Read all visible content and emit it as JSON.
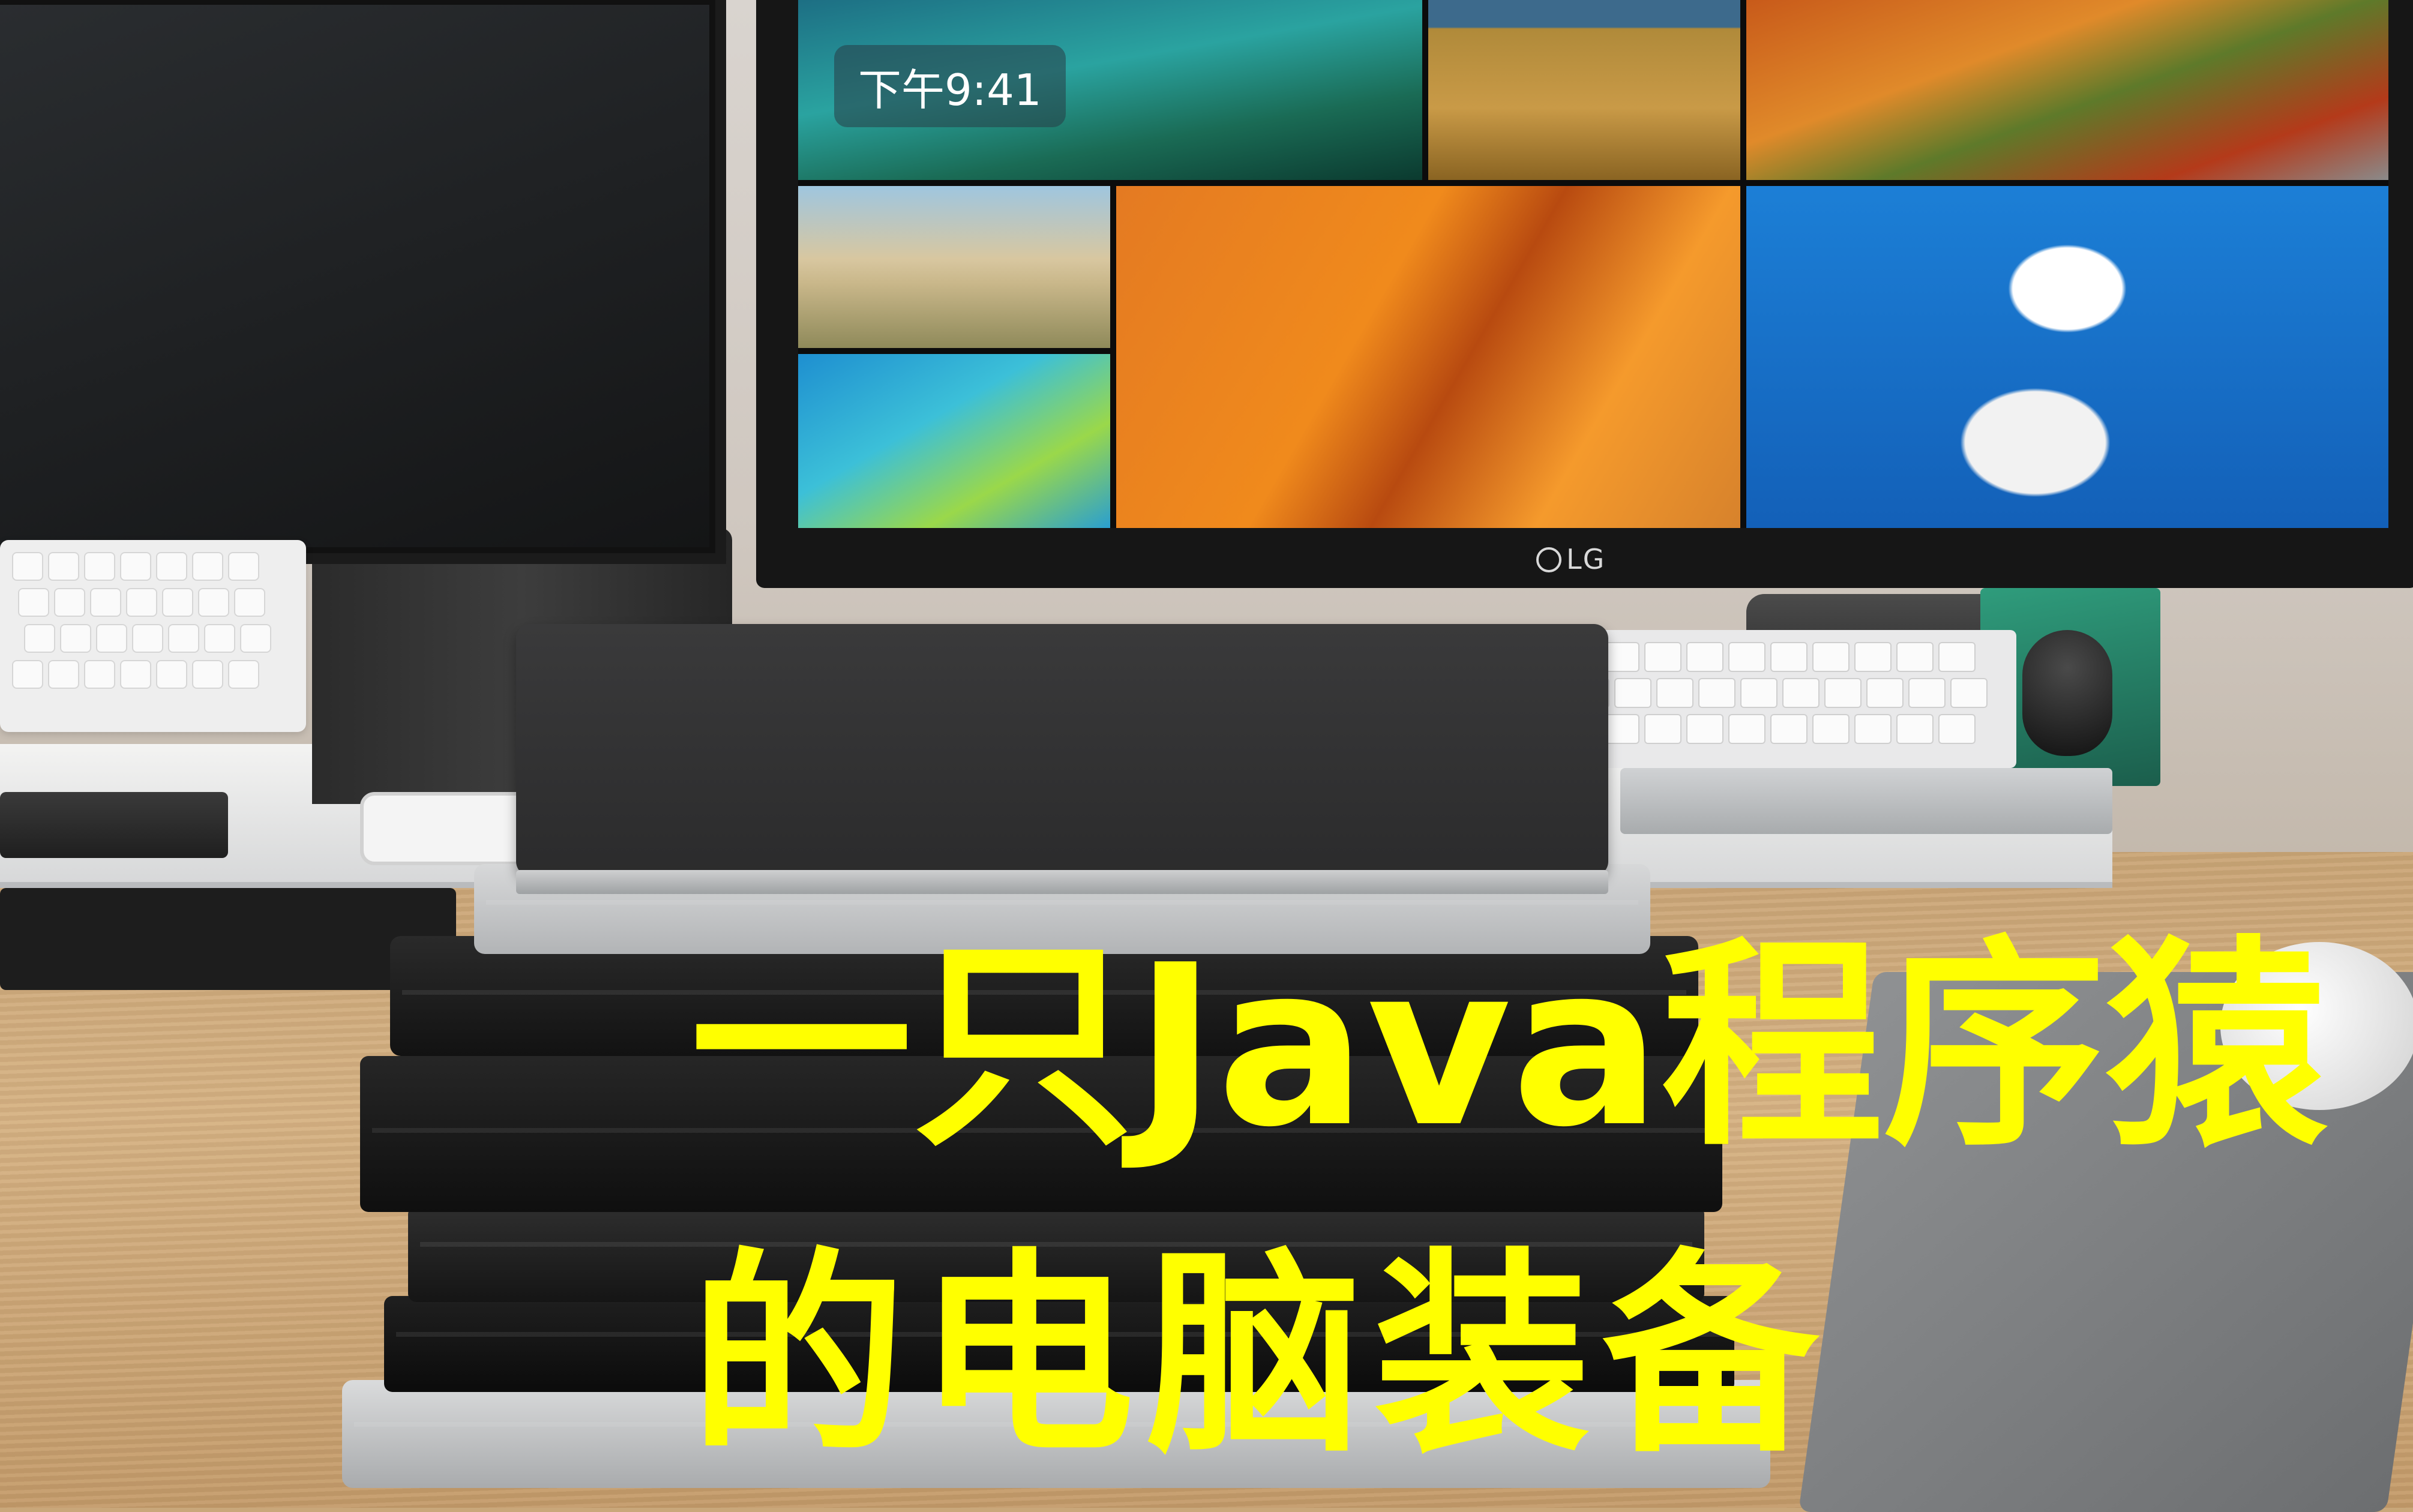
{
  "screen": {
    "clock_text": "下午9:41",
    "monitor_brand": "LG"
  },
  "caption": {
    "line1": "一只Java程序猿",
    "line2": "的电脑装备"
  }
}
